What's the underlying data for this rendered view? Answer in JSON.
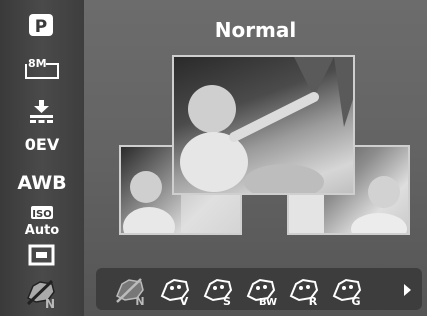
{
  "header": {
    "title": "Normal"
  },
  "sidebar": {
    "items": [
      {
        "icon": "program-mode-icon",
        "label": "P"
      },
      {
        "icon": "image-size-icon",
        "label": "8M"
      },
      {
        "icon": "quality-icon",
        "label": ""
      },
      {
        "icon": "exposure-icon",
        "label": "0EV"
      },
      {
        "icon": "white-balance-icon",
        "label": "AWB"
      },
      {
        "icon": "iso-icon",
        "label": "ISO",
        "sublabel": "Auto"
      },
      {
        "icon": "metering-icon",
        "label": ""
      },
      {
        "icon": "color-effect-normal-icon",
        "label": "N"
      }
    ]
  },
  "effects": {
    "items": [
      {
        "icon": "effect-normal-icon",
        "label": "N"
      },
      {
        "icon": "effect-vivid-icon",
        "label": "V"
      },
      {
        "icon": "effect-sepia-icon",
        "label": "S"
      },
      {
        "icon": "effect-bw-icon",
        "label": "BW"
      },
      {
        "icon": "effect-red-icon",
        "label": "R"
      },
      {
        "icon": "effect-green-icon",
        "label": "G"
      }
    ],
    "selected": "Normal"
  },
  "colors": {
    "sidebar": "#444444",
    "panel": "#666666",
    "strip": "#3d3d3d",
    "frame": "#cfcfcf"
  }
}
